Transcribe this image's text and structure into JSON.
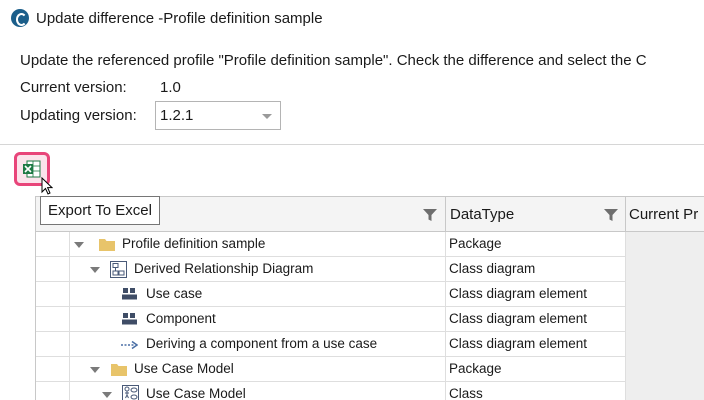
{
  "window": {
    "title": "Update difference -Profile definition sample",
    "app_icon": "app-logo-icon"
  },
  "instruction": "Update the referenced profile \"Profile definition sample\". Check the difference and select the C",
  "current_version": {
    "label": "Current version:",
    "value": "1.0"
  },
  "updating_version": {
    "label": "Updating version:",
    "value": "1.2.1"
  },
  "toolbar": {
    "export_icon": "excel-export-icon",
    "tooltip": "Export To Excel"
  },
  "grid": {
    "columns": [
      {
        "label": "",
        "filter_icon": "filter-icon"
      },
      {
        "label": "DataType",
        "filter_icon": "filter-icon"
      },
      {
        "label": "Current Pr"
      }
    ],
    "rows": [
      {
        "name": "Profile definition sample",
        "type": "Package",
        "icon": "folder-icon",
        "expanded": true
      },
      {
        "name": "Derived Relationship Diagram",
        "type": "Class diagram",
        "icon": "class-diagram-icon",
        "expanded": true
      },
      {
        "name": "Use case",
        "type": "Class diagram element",
        "icon": "element-icon"
      },
      {
        "name": "Component",
        "type": "Class diagram element",
        "icon": "element-icon"
      },
      {
        "name": "Deriving a component from a use case",
        "type": "Class diagram element",
        "icon": "dependency-icon"
      },
      {
        "name": "Use Case Model",
        "type": "Package",
        "icon": "folder-icon",
        "expanded": true
      },
      {
        "name": "Use Case Model",
        "type": "Class",
        "icon": "class-icon",
        "expanded": true
      }
    ]
  },
  "colors": {
    "highlight": "#e8457a",
    "folder": "#e8c46a",
    "excel": "#1f7a45"
  }
}
